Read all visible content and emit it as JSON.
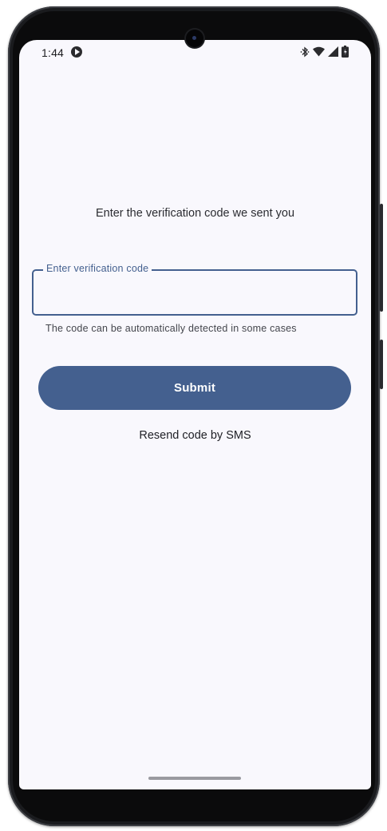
{
  "status_bar": {
    "time": "1:44",
    "app_icon": "media-play-icon",
    "icons": [
      "bluetooth-icon",
      "wifi-icon",
      "signal-icon",
      "battery-icon"
    ]
  },
  "verification": {
    "instruction": "Enter the verification code we sent you",
    "field_label": "Enter verification code",
    "field_value": "",
    "helper_text": "The code can be automatically detected in some cases",
    "submit_label": "Submit",
    "resend_label": "Resend code by SMS"
  },
  "colors": {
    "accent": "#44608f",
    "background": "#f9f8fd",
    "text": "#2b2c31"
  }
}
